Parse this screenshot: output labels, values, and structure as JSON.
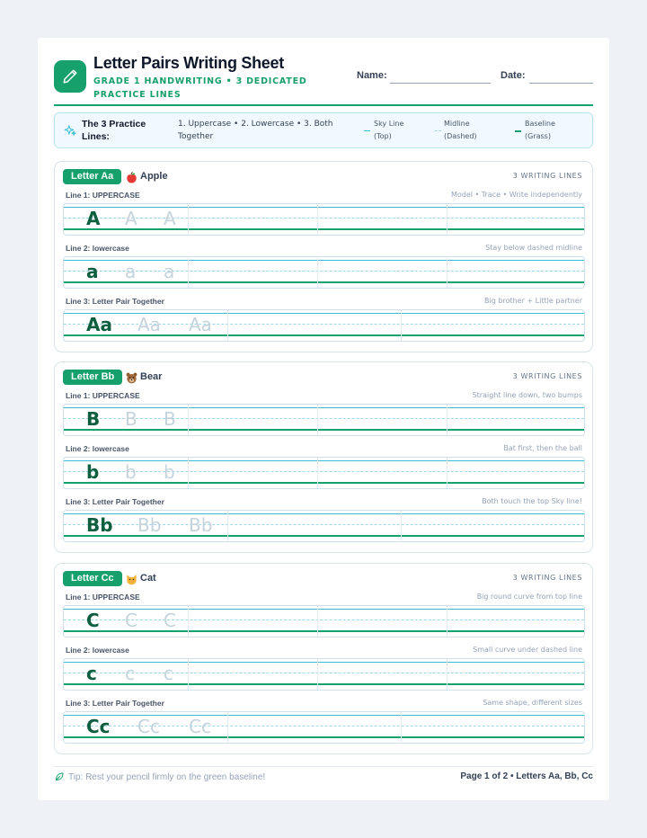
{
  "header": {
    "title": "Letter Pairs Writing Sheet",
    "subtitle": "GRADE 1 HANDWRITING • 3 DEDICATED PRACTICE LINES",
    "name_label": "Name:",
    "date_label": "Date:"
  },
  "legend": {
    "title": "The 3 Practice Lines:",
    "description": "1. Uppercase • 2. Lowercase • 3. Both Together",
    "sky": "Sky Line (Top)",
    "midline": "Midline (Dashed)",
    "baseline": "Baseline (Grass)"
  },
  "cards": [
    {
      "letter_label": "Letter Aa",
      "emoji": "apple-icon",
      "word": "Apple",
      "lines_label": "3 WRITING LINES",
      "rows": [
        {
          "label": "Line 1: UPPERCASE",
          "hint": "Model • Trace • Write independently",
          "glyph": "A"
        },
        {
          "label": "Line 2: lowercase",
          "hint": "Stay below dashed midline",
          "glyph": "a"
        },
        {
          "label": "Line 3: Letter Pair Together",
          "hint": "Big brother + Little partner",
          "glyph": "Aa"
        }
      ]
    },
    {
      "letter_label": "Letter Bb",
      "emoji": "bear-icon",
      "word": "Bear",
      "lines_label": "3 WRITING LINES",
      "rows": [
        {
          "label": "Line 1: UPPERCASE",
          "hint": "Straight line down, two bumps",
          "glyph": "B"
        },
        {
          "label": "Line 2: lowercase",
          "hint": "Bat first, then the ball",
          "glyph": "b"
        },
        {
          "label": "Line 3: Letter Pair Together",
          "hint": "Both touch the top Sky line!",
          "glyph": "Bb"
        }
      ]
    },
    {
      "letter_label": "Letter Cc",
      "emoji": "cat-icon",
      "word": "Cat",
      "lines_label": "3 WRITING LINES",
      "rows": [
        {
          "label": "Line 1: UPPERCASE",
          "hint": "Big round curve from top line",
          "glyph": "C"
        },
        {
          "label": "Line 2: lowercase",
          "hint": "Small curve under dashed line",
          "glyph": "c"
        },
        {
          "label": "Line 3: Letter Pair Together",
          "hint": "Same shape, different sizes",
          "glyph": "Cc"
        }
      ]
    }
  ],
  "footer": {
    "tip": "Tip: Rest your pencil firmly on the green baseline!",
    "page": "Page 1 of 2 • Letters Aa, Bb, Cc"
  },
  "colors": {
    "accent": "#16a06b",
    "model_glyph": "#0d5f3f",
    "trace_glyph": "#c5d3dc",
    "sky_line": "#38bdd8",
    "midline": "#9dd8ea"
  }
}
